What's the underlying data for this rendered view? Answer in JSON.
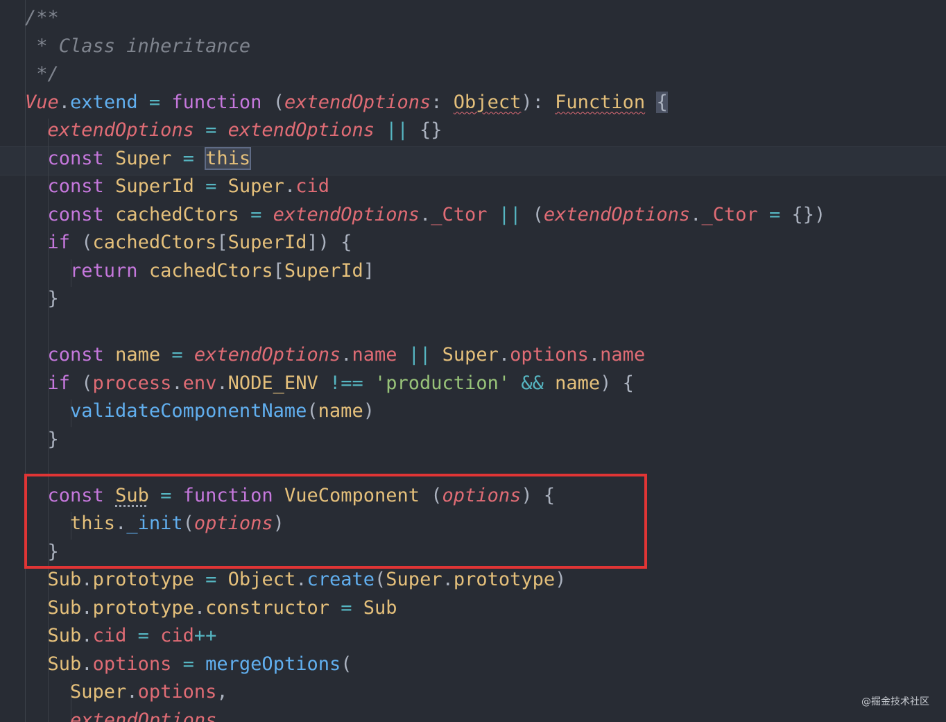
{
  "lines": [
    [
      {
        "t": "/**",
        "c": "c-comment"
      }
    ],
    [
      {
        "t": " * Class inheritance",
        "c": "c-comment"
      }
    ],
    [
      {
        "t": " */",
        "c": "c-comment"
      }
    ],
    [
      {
        "t": "Vue",
        "c": "c-var-it"
      },
      {
        "t": ".",
        "c": "c-punc"
      },
      {
        "t": "extend",
        "c": "c-fn"
      },
      {
        "t": " ",
        "c": "c-punc"
      },
      {
        "t": "=",
        "c": "c-op"
      },
      {
        "t": " ",
        "c": "c-punc"
      },
      {
        "t": "function",
        "c": "c-kw"
      },
      {
        "t": " (",
        "c": "c-punc"
      },
      {
        "t": "extendOptions",
        "c": "c-param"
      },
      {
        "t": ": ",
        "c": "c-punc"
      },
      {
        "t": "Object",
        "c": "c-type squiggle"
      },
      {
        "t": "): ",
        "c": "c-punc"
      },
      {
        "t": "Function",
        "c": "c-type squiggle"
      },
      {
        "t": " ",
        "c": "c-punc"
      },
      {
        "t": "{",
        "c": "c-punc brace-hl"
      }
    ],
    [
      {
        "t": "  ",
        "c": "c-punc"
      },
      {
        "t": "extendOptions",
        "c": "c-param"
      },
      {
        "t": " ",
        "c": "c-punc"
      },
      {
        "t": "=",
        "c": "c-op"
      },
      {
        "t": " ",
        "c": "c-punc"
      },
      {
        "t": "extendOptions",
        "c": "c-param"
      },
      {
        "t": " ",
        "c": "c-punc"
      },
      {
        "t": "||",
        "c": "c-op"
      },
      {
        "t": " {}",
        "c": "c-punc"
      }
    ],
    [
      {
        "t": "  ",
        "c": "c-punc"
      },
      {
        "t": "const",
        "c": "c-kw"
      },
      {
        "t": " ",
        "c": "c-punc"
      },
      {
        "t": "Super",
        "c": "c-var"
      },
      {
        "t": " ",
        "c": "c-punc"
      },
      {
        "t": "=",
        "c": "c-op"
      },
      {
        "t": " ",
        "c": "c-punc"
      },
      {
        "t": "this",
        "c": "c-this this-hl"
      }
    ],
    [
      {
        "t": "  ",
        "c": "c-punc"
      },
      {
        "t": "const",
        "c": "c-kw"
      },
      {
        "t": " ",
        "c": "c-punc"
      },
      {
        "t": "SuperId",
        "c": "c-var"
      },
      {
        "t": " ",
        "c": "c-punc"
      },
      {
        "t": "=",
        "c": "c-op"
      },
      {
        "t": " ",
        "c": "c-punc"
      },
      {
        "t": "Super",
        "c": "c-var"
      },
      {
        "t": ".",
        "c": "c-punc"
      },
      {
        "t": "cid",
        "c": "c-prop"
      }
    ],
    [
      {
        "t": "  ",
        "c": "c-punc"
      },
      {
        "t": "const",
        "c": "c-kw"
      },
      {
        "t": " ",
        "c": "c-punc"
      },
      {
        "t": "cachedCtors",
        "c": "c-var"
      },
      {
        "t": " ",
        "c": "c-punc"
      },
      {
        "t": "=",
        "c": "c-op"
      },
      {
        "t": " ",
        "c": "c-punc"
      },
      {
        "t": "extendOptions",
        "c": "c-param"
      },
      {
        "t": ".",
        "c": "c-punc"
      },
      {
        "t": "_Ctor",
        "c": "c-prop"
      },
      {
        "t": " ",
        "c": "c-punc"
      },
      {
        "t": "||",
        "c": "c-op"
      },
      {
        "t": " (",
        "c": "c-punc"
      },
      {
        "t": "extendOptions",
        "c": "c-param"
      },
      {
        "t": ".",
        "c": "c-punc"
      },
      {
        "t": "_Ctor",
        "c": "c-prop"
      },
      {
        "t": " ",
        "c": "c-punc"
      },
      {
        "t": "=",
        "c": "c-op"
      },
      {
        "t": " {})",
        "c": "c-punc"
      }
    ],
    [
      {
        "t": "  ",
        "c": "c-punc"
      },
      {
        "t": "if",
        "c": "c-kw"
      },
      {
        "t": " (",
        "c": "c-punc"
      },
      {
        "t": "cachedCtors",
        "c": "c-var"
      },
      {
        "t": "[",
        "c": "c-punc"
      },
      {
        "t": "SuperId",
        "c": "c-var"
      },
      {
        "t": "]) {",
        "c": "c-punc"
      }
    ],
    [
      {
        "t": "    ",
        "c": "c-punc"
      },
      {
        "t": "return",
        "c": "c-kw"
      },
      {
        "t": " ",
        "c": "c-punc"
      },
      {
        "t": "cachedCtors",
        "c": "c-var"
      },
      {
        "t": "[",
        "c": "c-punc"
      },
      {
        "t": "SuperId",
        "c": "c-var"
      },
      {
        "t": "]",
        "c": "c-punc"
      }
    ],
    [
      {
        "t": "  }",
        "c": "c-punc"
      }
    ],
    [],
    [
      {
        "t": "  ",
        "c": "c-punc"
      },
      {
        "t": "const",
        "c": "c-kw"
      },
      {
        "t": " ",
        "c": "c-punc"
      },
      {
        "t": "name",
        "c": "c-var"
      },
      {
        "t": " ",
        "c": "c-punc"
      },
      {
        "t": "=",
        "c": "c-op"
      },
      {
        "t": " ",
        "c": "c-punc"
      },
      {
        "t": "extendOptions",
        "c": "c-param"
      },
      {
        "t": ".",
        "c": "c-punc"
      },
      {
        "t": "name",
        "c": "c-prop"
      },
      {
        "t": " ",
        "c": "c-punc"
      },
      {
        "t": "||",
        "c": "c-op"
      },
      {
        "t": " ",
        "c": "c-punc"
      },
      {
        "t": "Super",
        "c": "c-var"
      },
      {
        "t": ".",
        "c": "c-punc"
      },
      {
        "t": "options",
        "c": "c-prop"
      },
      {
        "t": ".",
        "c": "c-punc"
      },
      {
        "t": "name",
        "c": "c-prop"
      }
    ],
    [
      {
        "t": "  ",
        "c": "c-punc"
      },
      {
        "t": "if",
        "c": "c-kw"
      },
      {
        "t": " (",
        "c": "c-punc"
      },
      {
        "t": "process",
        "c": "c-prop"
      },
      {
        "t": ".",
        "c": "c-punc"
      },
      {
        "t": "env",
        "c": "c-prop"
      },
      {
        "t": ".",
        "c": "c-punc"
      },
      {
        "t": "NODE_ENV",
        "c": "c-var"
      },
      {
        "t": " ",
        "c": "c-punc"
      },
      {
        "t": "!==",
        "c": "c-op"
      },
      {
        "t": " ",
        "c": "c-punc"
      },
      {
        "t": "'production'",
        "c": "c-str"
      },
      {
        "t": " ",
        "c": "c-punc"
      },
      {
        "t": "&&",
        "c": "c-op"
      },
      {
        "t": " ",
        "c": "c-punc"
      },
      {
        "t": "name",
        "c": "c-var"
      },
      {
        "t": ") {",
        "c": "c-punc"
      }
    ],
    [
      {
        "t": "    ",
        "c": "c-punc"
      },
      {
        "t": "validateComponentName",
        "c": "c-fn"
      },
      {
        "t": "(",
        "c": "c-punc"
      },
      {
        "t": "name",
        "c": "c-var"
      },
      {
        "t": ")",
        "c": "c-punc"
      }
    ],
    [
      {
        "t": "  }",
        "c": "c-punc"
      }
    ],
    [],
    [
      {
        "t": "  ",
        "c": "c-punc"
      },
      {
        "t": "const",
        "c": "c-kw"
      },
      {
        "t": " ",
        "c": "c-punc"
      },
      {
        "t": "Sub",
        "c": "c-var dotted"
      },
      {
        "t": " ",
        "c": "c-punc"
      },
      {
        "t": "=",
        "c": "c-op"
      },
      {
        "t": " ",
        "c": "c-punc"
      },
      {
        "t": "function",
        "c": "c-kw"
      },
      {
        "t": " ",
        "c": "c-punc"
      },
      {
        "t": "VueComponent",
        "c": "c-var"
      },
      {
        "t": " (",
        "c": "c-punc"
      },
      {
        "t": "options",
        "c": "c-param"
      },
      {
        "t": ") {",
        "c": "c-punc"
      }
    ],
    [
      {
        "t": "    ",
        "c": "c-punc"
      },
      {
        "t": "this",
        "c": "c-this"
      },
      {
        "t": ".",
        "c": "c-punc"
      },
      {
        "t": "_init",
        "c": "c-fn"
      },
      {
        "t": "(",
        "c": "c-punc"
      },
      {
        "t": "options",
        "c": "c-param"
      },
      {
        "t": ")",
        "c": "c-punc"
      }
    ],
    [
      {
        "t": "  }",
        "c": "c-punc"
      }
    ],
    [
      {
        "t": "  ",
        "c": "c-punc"
      },
      {
        "t": "Sub",
        "c": "c-var"
      },
      {
        "t": ".",
        "c": "c-punc"
      },
      {
        "t": "prototype",
        "c": "c-var"
      },
      {
        "t": " ",
        "c": "c-punc"
      },
      {
        "t": "=",
        "c": "c-op"
      },
      {
        "t": " ",
        "c": "c-punc"
      },
      {
        "t": "Object",
        "c": "c-var"
      },
      {
        "t": ".",
        "c": "c-punc"
      },
      {
        "t": "create",
        "c": "c-fn"
      },
      {
        "t": "(",
        "c": "c-punc"
      },
      {
        "t": "Super",
        "c": "c-var"
      },
      {
        "t": ".",
        "c": "c-punc"
      },
      {
        "t": "prototype",
        "c": "c-var"
      },
      {
        "t": ")",
        "c": "c-punc"
      }
    ],
    [
      {
        "t": "  ",
        "c": "c-punc"
      },
      {
        "t": "Sub",
        "c": "c-var"
      },
      {
        "t": ".",
        "c": "c-punc"
      },
      {
        "t": "prototype",
        "c": "c-var"
      },
      {
        "t": ".",
        "c": "c-punc"
      },
      {
        "t": "constructor",
        "c": "c-var"
      },
      {
        "t": " ",
        "c": "c-punc"
      },
      {
        "t": "=",
        "c": "c-op"
      },
      {
        "t": " ",
        "c": "c-punc"
      },
      {
        "t": "Sub",
        "c": "c-var"
      }
    ],
    [
      {
        "t": "  ",
        "c": "c-punc"
      },
      {
        "t": "Sub",
        "c": "c-var"
      },
      {
        "t": ".",
        "c": "c-punc"
      },
      {
        "t": "cid",
        "c": "c-prop"
      },
      {
        "t": " ",
        "c": "c-punc"
      },
      {
        "t": "=",
        "c": "c-op"
      },
      {
        "t": " ",
        "c": "c-punc"
      },
      {
        "t": "cid",
        "c": "c-prop"
      },
      {
        "t": "++",
        "c": "c-op"
      }
    ],
    [
      {
        "t": "  ",
        "c": "c-punc"
      },
      {
        "t": "Sub",
        "c": "c-var"
      },
      {
        "t": ".",
        "c": "c-punc"
      },
      {
        "t": "options",
        "c": "c-prop"
      },
      {
        "t": " ",
        "c": "c-punc"
      },
      {
        "t": "=",
        "c": "c-op"
      },
      {
        "t": " ",
        "c": "c-punc"
      },
      {
        "t": "mergeOptions",
        "c": "c-fn"
      },
      {
        "t": "(",
        "c": "c-punc"
      }
    ],
    [
      {
        "t": "    ",
        "c": "c-punc"
      },
      {
        "t": "Super",
        "c": "c-var"
      },
      {
        "t": ".",
        "c": "c-punc"
      },
      {
        "t": "options",
        "c": "c-prop"
      },
      {
        "t": ",",
        "c": "c-punc"
      }
    ],
    [
      {
        "t": "    ",
        "c": "c-punc"
      },
      {
        "t": "extendOptions",
        "c": "c-param"
      }
    ]
  ],
  "watermark": "@掘金技术社区",
  "colors": {
    "background": "#282c34",
    "highlight_box": "#e03535"
  }
}
